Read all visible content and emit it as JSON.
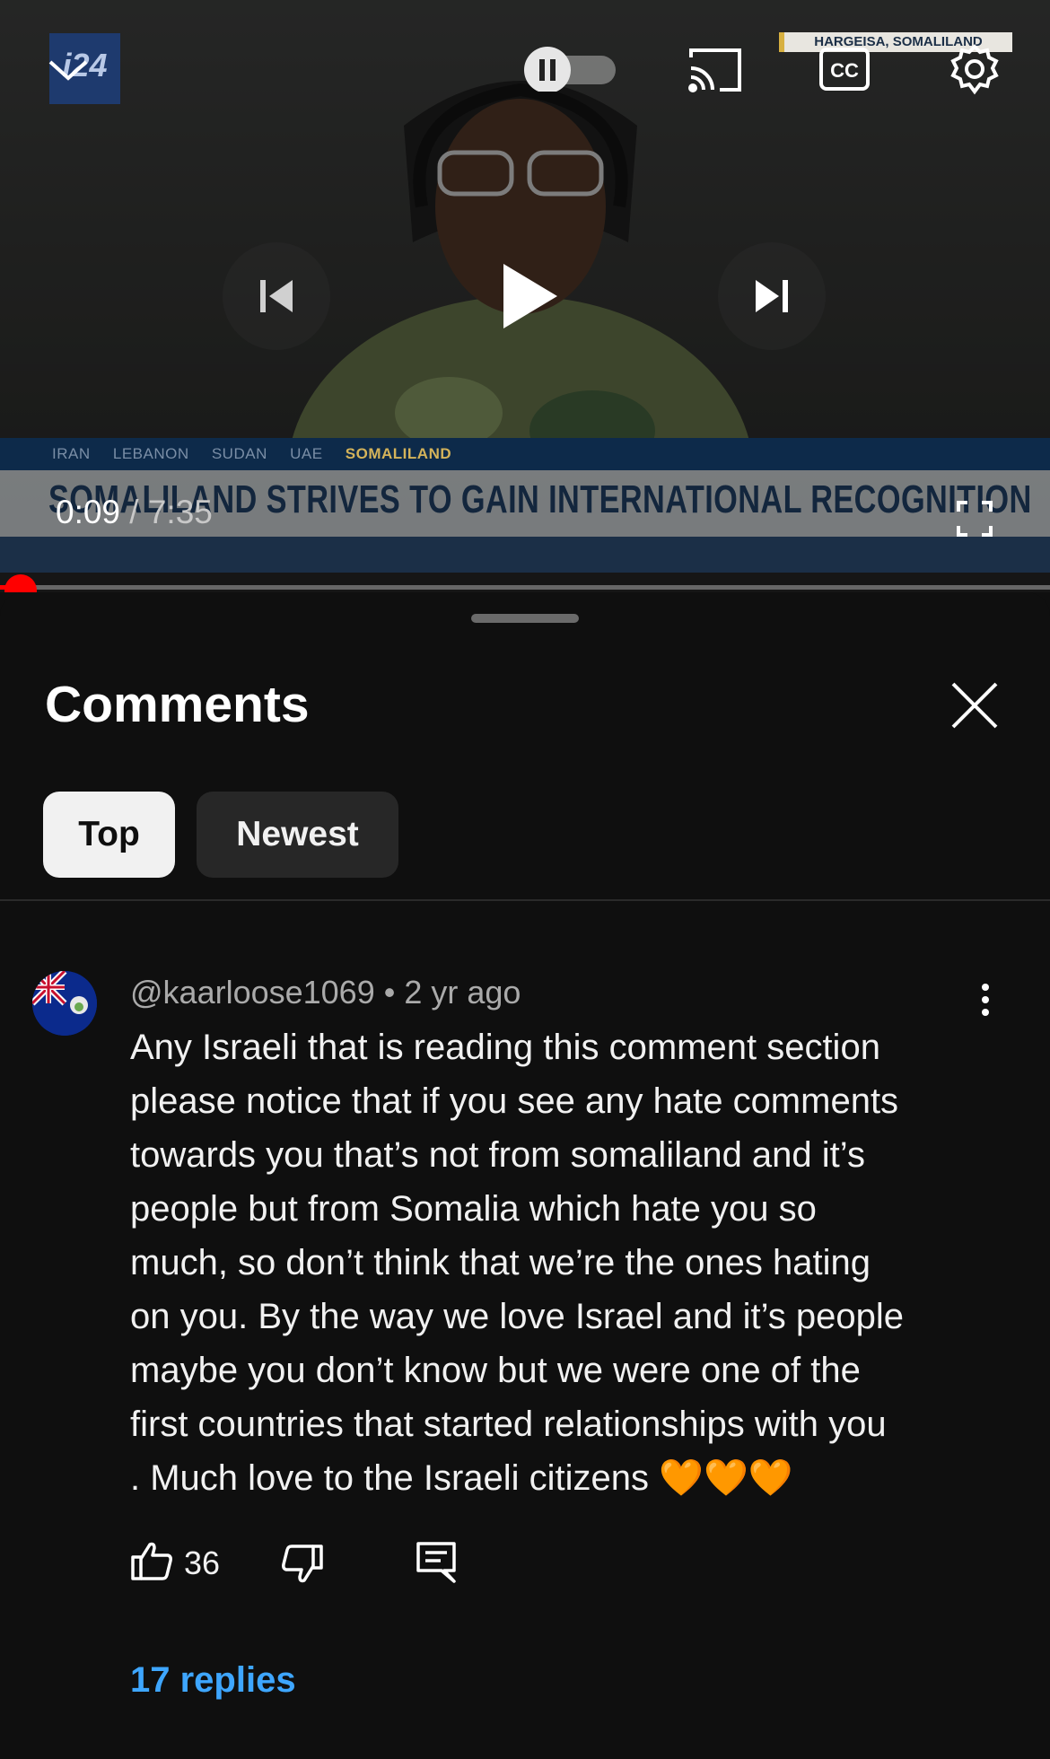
{
  "video": {
    "channel_logo_text": "i24",
    "location_label": "HARGEISA, SOMALILAND",
    "ticker_tags": [
      "IRAN",
      "LEBANON",
      "SUDAN",
      "UAE",
      "SOMALILAND"
    ],
    "headline": "SOMALILAND STRIVES TO GAIN INTERNATIONAL RECOGNITION",
    "current_time": "0:09",
    "duration": "/ 7:35",
    "progress_fraction": 0.02,
    "autoplay_on": false
  },
  "comments_panel": {
    "title": "Comments",
    "sort_tabs": [
      {
        "label": "Top",
        "selected": true
      },
      {
        "label": "Newest",
        "selected": false
      }
    ]
  },
  "comment": {
    "author": "@kaarloose1069",
    "separator": "•",
    "age": "2 yr ago",
    "text": "Any Israeli that is reading this comment section\nplease notice that if you see any hate comments\ntowards you that’s not from somaliland and it’s\npeople but from Somalia which hate you so\nmuch, so don’t think that we’re the ones hating\non you. By the way we love Israel and it’s people\nmaybe you don’t know but we were one of the\nfirst countries that started relationships with you\n. Much love to the Israeli citizens 🧡🧡🧡",
    "likes": "36",
    "replies_label": "17 replies"
  },
  "colors": {
    "background": "#0f0f0f",
    "accent_link": "#3ea6ff",
    "progress": "#ff0000"
  },
  "icons": [
    "collapse-chevron-icon",
    "pause-icon",
    "cast-icon",
    "captions-icon",
    "settings-gear-icon",
    "previous-icon",
    "play-icon",
    "next-icon",
    "fullscreen-icon",
    "close-icon",
    "more-vert-icon",
    "thumbs-up-icon",
    "thumbs-down-icon",
    "reply-icon"
  ]
}
